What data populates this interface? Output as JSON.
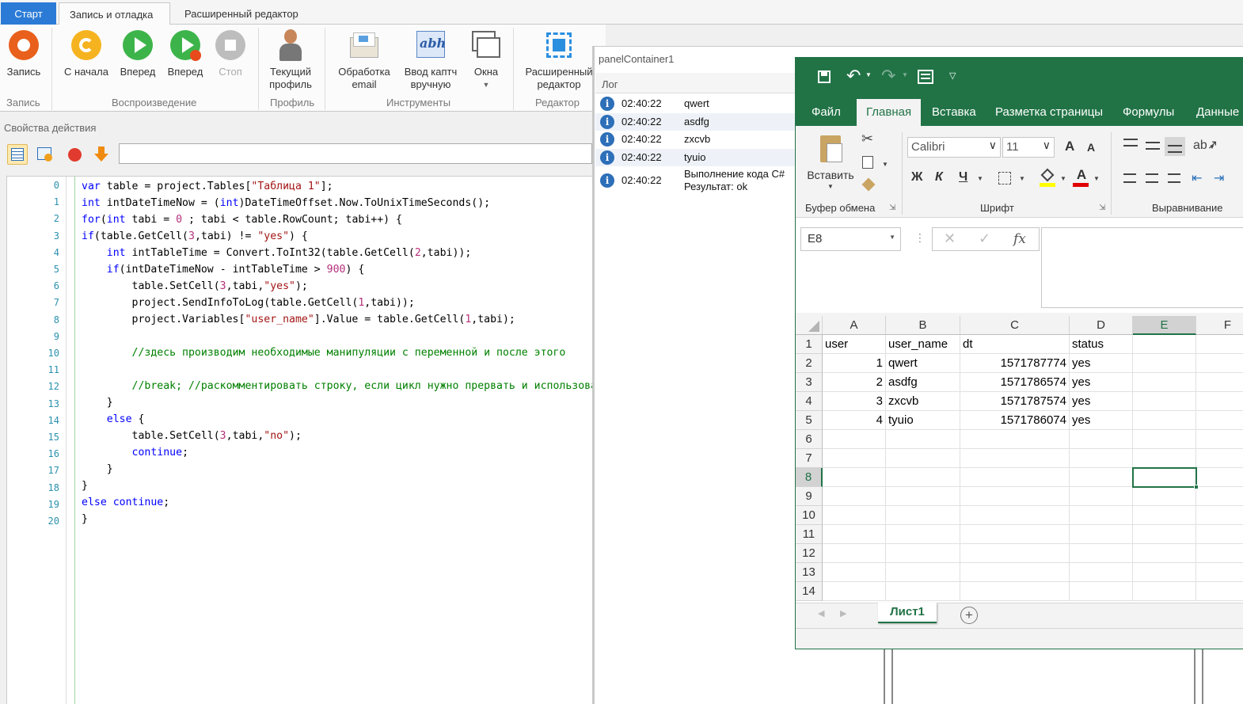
{
  "ribbon": {
    "tabs": {
      "start": "Старт",
      "record_debug": "Запись и отладка",
      "advanced": "Расширенный редактор"
    },
    "buttons": {
      "record": "Запись",
      "from_start": "С начала",
      "forward1": "Вперед",
      "forward2": "Вперед",
      "stop": "Стоп",
      "profile": "Текущий профиль",
      "email": "Обработка email",
      "captcha": "Ввод каптч вручную",
      "windows": "Окна",
      "adv_editor": "Расширенный редактор"
    },
    "groups": {
      "record": "Запись",
      "playback": "Воспроизведение",
      "profile": "Профиль",
      "tools": "Инструменты",
      "editor": "Редактор"
    }
  },
  "properties": {
    "title": "Свойства действия",
    "input_value": ""
  },
  "code": {
    "line_numbers": [
      "0",
      "1",
      "2",
      "3",
      "4",
      "5",
      "6",
      "7",
      "8",
      "9",
      "10",
      "11",
      "12",
      "13",
      "14",
      "15",
      "16",
      "17",
      "18",
      "19",
      "20"
    ]
  },
  "panel": {
    "title": "panelContainer1",
    "log_title": "Лог",
    "log": [
      {
        "time": "02:40:22",
        "msg": "qwert"
      },
      {
        "time": "02:40:22",
        "msg": "asdfg"
      },
      {
        "time": "02:40:22",
        "msg": "zxcvb"
      },
      {
        "time": "02:40:22",
        "msg": "tyuio"
      },
      {
        "time": "02:40:22",
        "msg": "Выполнение кода C#",
        "msg2": "Результат: ok"
      }
    ]
  },
  "excel": {
    "menu": [
      "Файл",
      "Главная",
      "Вставка",
      "Разметка страницы",
      "Формулы",
      "Данные"
    ],
    "clipboard": {
      "paste": "Вставить",
      "group": "Буфер обмена"
    },
    "font": {
      "name": "Calibri",
      "size": "11",
      "bold": "Ж",
      "italic": "К",
      "underline": "Ч",
      "grow": "A",
      "shrink": "A",
      "group": "Шрифт"
    },
    "align_group": "Выравнивание",
    "name_box": "E8",
    "fx": "fx",
    "columns": [
      "A",
      "B",
      "C",
      "D",
      "E",
      "F"
    ],
    "rows": [
      "1",
      "2",
      "3",
      "4",
      "5",
      "6",
      "7",
      "8",
      "9",
      "10",
      "11",
      "12",
      "13",
      "14"
    ],
    "cells": [
      [
        "user",
        "user_name",
        "dt",
        "status"
      ],
      [
        "1",
        "qwert",
        "1571787774",
        "yes"
      ],
      [
        "2",
        "asdfg",
        "1571786574",
        "yes"
      ],
      [
        "3",
        "zxcvb",
        "1571787574",
        "yes"
      ],
      [
        "4",
        "tyuio",
        "1571786074",
        "yes"
      ]
    ],
    "sheet": "Лист1",
    "colors": {
      "brand": "#217346"
    }
  }
}
